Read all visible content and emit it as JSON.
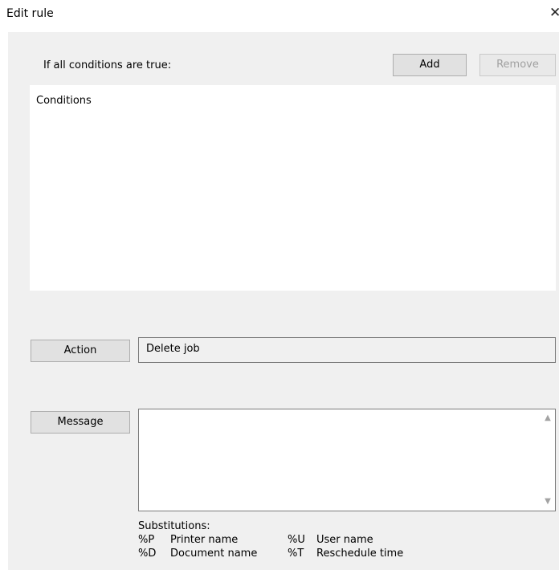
{
  "window": {
    "title": "Edit rule",
    "close_glyph": "✕"
  },
  "conditions": {
    "label": "If all conditions are true:",
    "add_label": "Add",
    "remove_label": "Remove",
    "list_header": "Conditions"
  },
  "action": {
    "button_label": "Action",
    "value": "Delete job"
  },
  "message": {
    "button_label": "Message",
    "value": ""
  },
  "substitutions": {
    "title": "Substitutions:",
    "rows": [
      {
        "code1": "%P",
        "desc1": "Printer name",
        "code2": "%U",
        "desc2": "User name"
      },
      {
        "code1": "%D",
        "desc1": "Document name",
        "code2": "%T",
        "desc2": "Reschedule time"
      }
    ]
  },
  "icons": {
    "close": "close-icon",
    "scroll_up": "chevron-up-icon",
    "scroll_down": "chevron-down-icon"
  }
}
